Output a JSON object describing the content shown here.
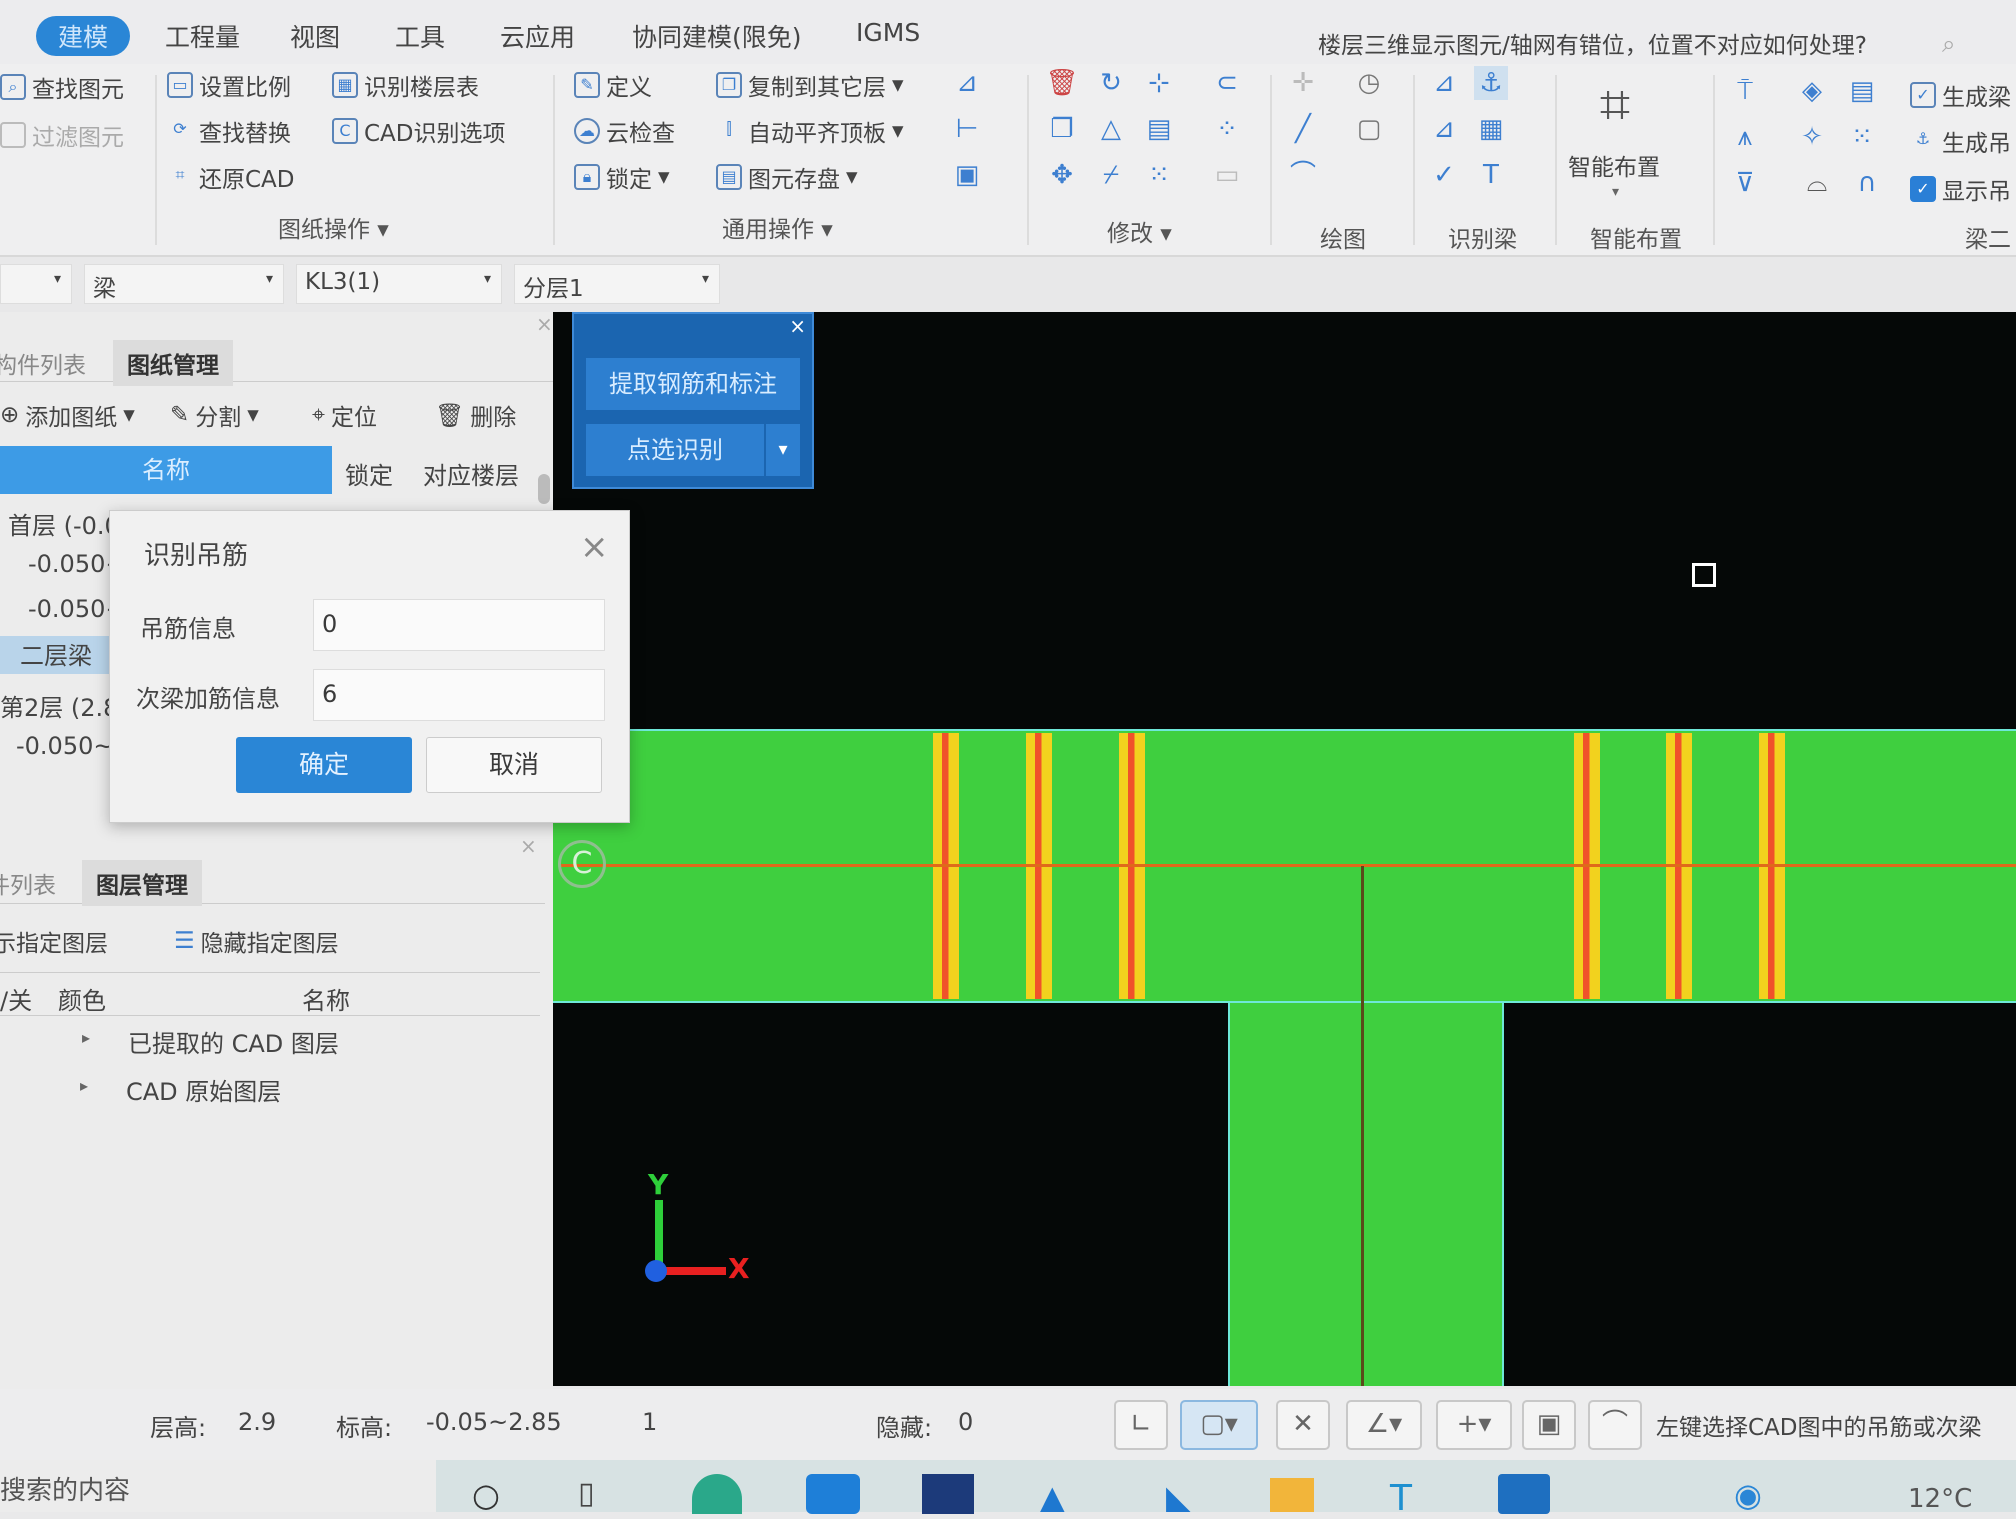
{
  "menu": {
    "tabs": [
      "建模",
      "工程量",
      "视图",
      "工具",
      "云应用",
      "协同建模(限免)",
      "IGMS"
    ],
    "active": "建模",
    "help_text": "楼层三维显示图元/轴网有错位，位置不对应如何处理?"
  },
  "ribbon": {
    "select": {
      "find": "查找图元",
      "filter": "过滤图元"
    },
    "drawing_ops": {
      "label": "图纸操作",
      "items": [
        "设置比例",
        "识别楼层表",
        "查找替换",
        "CAD识别选项",
        "还原CAD"
      ]
    },
    "common_ops": {
      "label": "通用操作",
      "items": [
        "定义",
        "复制到其它层",
        "云检查",
        "自动平齐顶板",
        "锁定",
        "图元存盘"
      ]
    },
    "modify": {
      "label": "修改"
    },
    "draw": {
      "label": "绘图"
    },
    "recognize_beam": {
      "label": "识别梁"
    },
    "smart_layout": {
      "label": "智能布置",
      "button": "智能布置"
    },
    "beam_secondary": {
      "label": "梁二",
      "items": [
        "生成梁",
        "生成吊",
        "显示吊"
      ],
      "show_checked": true
    }
  },
  "selectors": {
    "type": "梁",
    "component": "KL3(1)",
    "layer": "分层1"
  },
  "drawing_panel": {
    "tabs": [
      "构件列表",
      "图纸管理"
    ],
    "toolbar": [
      "添加图纸",
      "分割",
      "定位",
      "删除"
    ],
    "columns": [
      "名称",
      "锁定",
      "对应楼层"
    ],
    "rows": [
      "首层 (-0.0",
      "-0.050~",
      "-0.050~",
      "二层梁",
      "第2层 (2.8",
      "-0.050~"
    ]
  },
  "layer_panel": {
    "tabs": [
      "构件列表",
      "图层管理"
    ],
    "toolbar": [
      "显示指定图层",
      "隐藏指定图层"
    ],
    "columns": [
      "开/关",
      "颜色",
      "名称"
    ],
    "rows": [
      "已提取的 CAD 图层",
      "CAD 原始图层"
    ]
  },
  "float_panel": {
    "extract_button": "提取钢筋和标注",
    "pick_button": "点选识别"
  },
  "dialog": {
    "title": "识别吊筋",
    "fields": [
      {
        "label": "吊筋信息",
        "value": "0"
      },
      {
        "label": "次梁加筋信息",
        "value": "6"
      }
    ],
    "ok": "确定",
    "cancel": "取消"
  },
  "canvas": {
    "axis_label": "C",
    "axis_x": "X",
    "axis_y": "Y",
    "beam_color": "#3fcf3f",
    "rebar_color": "#f2d21e"
  },
  "status": {
    "floor_height_label": "层高:",
    "floor_height": "2.9",
    "elevation_label": "标高:",
    "elevation": "-0.05~2.85",
    "count": "1",
    "hidden_label": "隐藏:",
    "hidden": "0",
    "hint": "左键选择CAD图中的吊筋或次梁"
  },
  "taskbar": {
    "search": "搜索的内容",
    "weather": "12°C"
  }
}
